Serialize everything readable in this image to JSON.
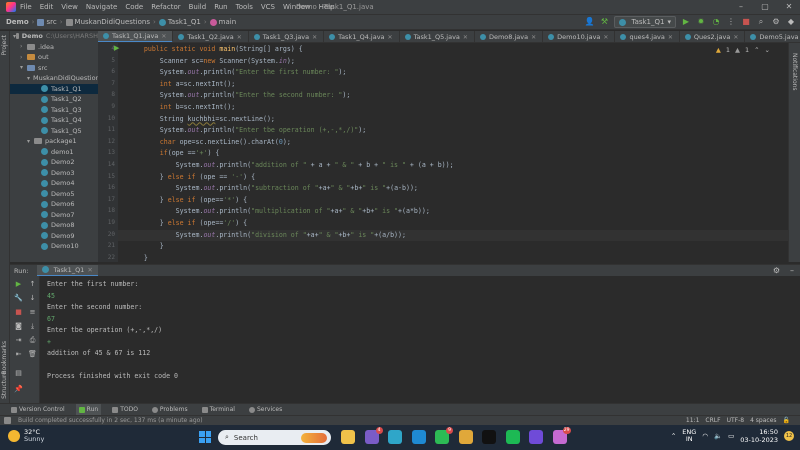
{
  "menu": {
    "items": [
      "File",
      "Edit",
      "View",
      "Navigate",
      "Code",
      "Refactor",
      "Build",
      "Run",
      "Tools",
      "VCS",
      "Window",
      "Help"
    ],
    "window_title": "Demo - Task1_Q1.java"
  },
  "navbar": {
    "breadcrumbs": [
      "Demo",
      "src",
      "MuskanDidiQuestions",
      "Task1_Q1",
      "main"
    ],
    "run_config": "Task1_Q1"
  },
  "project": {
    "tool_label": "Project",
    "tree": [
      {
        "label": "Demo",
        "hint": "C:\\Users\\HARSH",
        "level": 0,
        "kind": "project",
        "arrow": "▾"
      },
      {
        "label": ".idea",
        "level": 1,
        "kind": "folder",
        "arrow": "›"
      },
      {
        "label": "out",
        "level": 1,
        "kind": "folder-orange",
        "arrow": "›"
      },
      {
        "label": "src",
        "level": 1,
        "kind": "folder-blue",
        "arrow": "▾"
      },
      {
        "label": "MuskanDidiQuestions",
        "level": 2,
        "kind": "folder",
        "arrow": "▾"
      },
      {
        "label": "Task1_Q1",
        "level": 3,
        "kind": "class",
        "arrow": "",
        "selected": true
      },
      {
        "label": "Task1_Q2",
        "level": 3,
        "kind": "class",
        "arrow": ""
      },
      {
        "label": "Task1_Q3",
        "level": 3,
        "kind": "class",
        "arrow": ""
      },
      {
        "label": "Task1_Q4",
        "level": 3,
        "kind": "class",
        "arrow": ""
      },
      {
        "label": "Task1_Q5",
        "level": 3,
        "kind": "class",
        "arrow": ""
      },
      {
        "label": "package1",
        "level": 2,
        "kind": "folder",
        "arrow": "▾"
      },
      {
        "label": "demo1",
        "level": 3,
        "kind": "class",
        "arrow": ""
      },
      {
        "label": "Demo2",
        "level": 3,
        "kind": "class",
        "arrow": ""
      },
      {
        "label": "Demo3",
        "level": 3,
        "kind": "class",
        "arrow": ""
      },
      {
        "label": "Demo4",
        "level": 3,
        "kind": "class",
        "arrow": ""
      },
      {
        "label": "Demo5",
        "level": 3,
        "kind": "class",
        "arrow": ""
      },
      {
        "label": "Demo6",
        "level": 3,
        "kind": "class",
        "arrow": ""
      },
      {
        "label": "Demo7",
        "level": 3,
        "kind": "class",
        "arrow": ""
      },
      {
        "label": "Demo8",
        "level": 3,
        "kind": "class",
        "arrow": ""
      },
      {
        "label": "Demo9",
        "level": 3,
        "kind": "class",
        "arrow": ""
      },
      {
        "label": "Demo10",
        "level": 3,
        "kind": "class",
        "arrow": ""
      }
    ]
  },
  "tabs": [
    {
      "label": "Task1_Q1.java",
      "active": true
    },
    {
      "label": "Task1_Q2.java"
    },
    {
      "label": "Task1_Q3.java"
    },
    {
      "label": "Task1_Q4.java"
    },
    {
      "label": "Task1_Q5.java"
    },
    {
      "label": "Demo8.java"
    },
    {
      "label": "Demo10.java"
    },
    {
      "label": "ques4.java"
    },
    {
      "label": "Ques2.java"
    },
    {
      "label": "Demo5.java"
    }
  ],
  "editor": {
    "inspections": {
      "warnings": "1",
      "weak": "1"
    },
    "right_strip_label": "Notifications",
    "lines": [
      {
        "n": "4",
        "html": "    <span class='kw'>public static void</span> <span class='mth'>main</span>(String[] args) {"
      },
      {
        "n": "5",
        "html": "        Scanner sc=<span class='kw'>new</span> Scanner(System.<span class='fld'>in</span>);"
      },
      {
        "n": "6",
        "html": "        System.<span class='fld'>out</span>.println(<span class='str'>\"Enter the first number: \"</span>);"
      },
      {
        "n": "7",
        "html": "        <span class='kw'>int</span> a=sc.nextInt();"
      },
      {
        "n": "8",
        "html": "        System.<span class='fld'>out</span>.println(<span class='str'>\"Enter the second number: \"</span>);"
      },
      {
        "n": "9",
        "html": "        <span class='kw'>int</span> b=sc.nextInt();"
      },
      {
        "n": "10",
        "html": "        String <span class='warnvar'>kuchbhi</span>=sc.nextLine();"
      },
      {
        "n": "11",
        "html": "        System.<span class='fld'>out</span>.println(<span class='str'>\"Enter tbe operation (+,-,*,/)\"</span>);"
      },
      {
        "n": "12",
        "html": "        <span class='kw'>char</span> ope=sc.nextLine().charAt(<span class='num'>0</span>);"
      },
      {
        "n": "13",
        "html": "        <span class='kw'>if</span>(ope ==<span class='chr'>'+'</span>) {"
      },
      {
        "n": "14",
        "html": "            System.<span class='fld'>out</span>.println(<span class='str'>\"addition of \"</span> + a + <span class='str'>\" & \"</span> + b + <span class='str'>\" is \"</span> + (a + b));"
      },
      {
        "n": "15",
        "html": "        } <span class='kw'>else if</span> (ope == <span class='chr'>'-'</span>) {"
      },
      {
        "n": "16",
        "html": "            System.<span class='fld'>out</span>.println(<span class='str'>\"subtraction of \"</span>+a+<span class='str'>\" & \"</span>+b+<span class='str'>\" is \"</span>+(a-b));"
      },
      {
        "n": "17",
        "html": "        } <span class='kw'>else if</span> (ope==<span class='chr'>'*'</span>) {"
      },
      {
        "n": "18",
        "html": "            System.<span class='fld'>out</span>.println(<span class='str'>\"multiplication of \"</span>+a+<span class='str'>\" & \"</span>+b+<span class='str'>\" is \"</span>+(a*b));"
      },
      {
        "n": "19",
        "html": "        } <span class='kw'>else if</span> (ope==<span class='chr'>'/'</span>) {"
      },
      {
        "n": "20",
        "html": "            System.<span class='fld'>out</span>.println(<span class='str'>\"division of \"</span>+a+<span class='str'>\" & \"</span>+b+<span class='str'>\" is \"</span>+(a/b));"
      },
      {
        "n": "21",
        "html": "        }"
      },
      {
        "n": "22",
        "html": "    }"
      }
    ]
  },
  "run": {
    "label": "Run:",
    "tab": "Task1_Q1",
    "console": [
      {
        "text": "Enter the first number:",
        "input": false
      },
      {
        "text": "45",
        "input": true
      },
      {
        "text": "Enter the second number:",
        "input": false
      },
      {
        "text": "67",
        "input": true
      },
      {
        "text": "Enter tbe operation (+,-,*,/)",
        "input": false
      },
      {
        "text": "+",
        "input": true
      },
      {
        "text": "addition of 45 & 67 is 112",
        "input": false
      },
      {
        "text": "",
        "input": false
      },
      {
        "text": "Process finished with exit code 0",
        "input": false
      }
    ],
    "side_labels": [
      "Bookmarks",
      "Structure"
    ]
  },
  "bottombar": {
    "items": [
      "Version Control",
      "Run",
      "TODO",
      "Problems",
      "Terminal",
      "Services"
    ]
  },
  "status": {
    "message": "Build completed successfully in 2 sec, 137 ms (a minute ago)",
    "position": "11:1",
    "line_sep": "CRLF",
    "encoding": "UTF-8",
    "indent": "4 spaces"
  },
  "taskbar": {
    "temp": "32°C",
    "weather": "Sunny",
    "search_placeholder": "Search",
    "apps": [
      {
        "name": "file-explorer",
        "color": "#f0c24a",
        "badge": ""
      },
      {
        "name": "store",
        "color": "#7a5cc7",
        "badge": "4"
      },
      {
        "name": "edge",
        "color": "#2fa6c9",
        "badge": ""
      },
      {
        "name": "vscode",
        "color": "#1f8ad2",
        "badge": ""
      },
      {
        "name": "whatsapp",
        "color": "#2dbb55",
        "badge": "9"
      },
      {
        "name": "chrome",
        "color": "#e0a83a",
        "badge": ""
      },
      {
        "name": "intellij",
        "color": "#111111",
        "badge": ""
      },
      {
        "name": "spotify",
        "color": "#1db954",
        "badge": ""
      },
      {
        "name": "app-purple",
        "color": "#6f4bd8",
        "badge": ""
      },
      {
        "name": "app-gallery",
        "color": "#c56ad1",
        "badge": "29"
      }
    ],
    "lang_top": "ENG",
    "lang_bottom": "IN",
    "time": "16:50",
    "date": "03-10-2023",
    "notif_count": "12"
  }
}
